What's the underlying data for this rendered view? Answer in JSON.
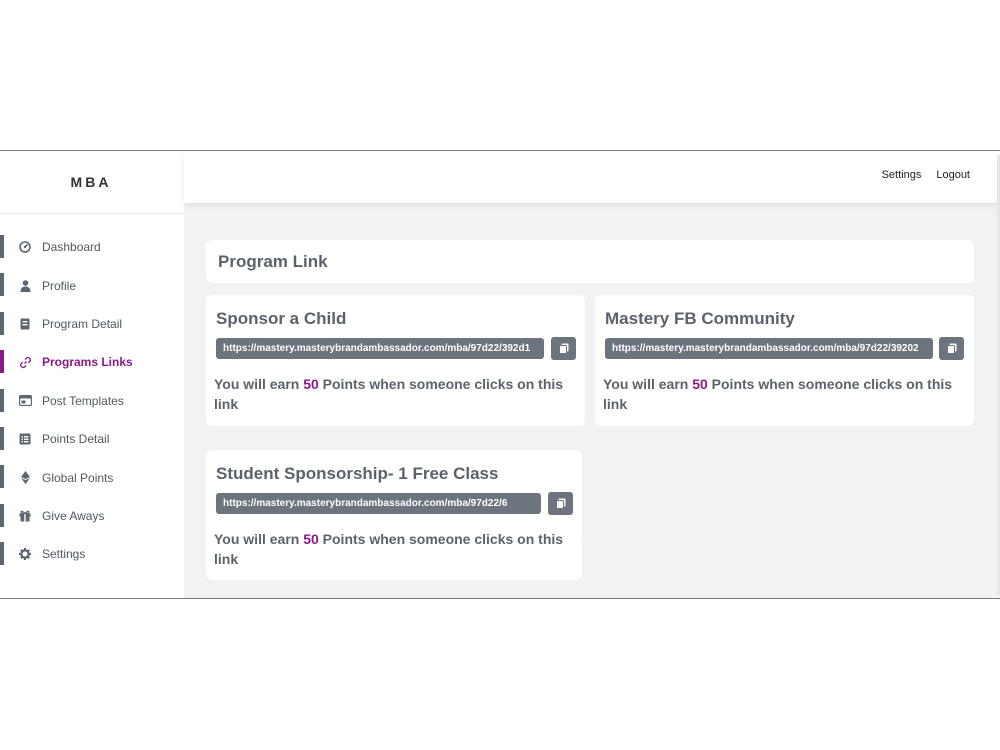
{
  "brand": "MBA",
  "topbar": {
    "settings": "Settings",
    "logout": "Logout"
  },
  "sidebar": {
    "items": [
      {
        "label": "Dashboard",
        "icon": "dashboard-gauge-icon"
      },
      {
        "label": "Profile",
        "icon": "user-icon"
      },
      {
        "label": "Program Detail",
        "icon": "file-icon"
      },
      {
        "label": "Programs Links",
        "icon": "link-icon",
        "active": true
      },
      {
        "label": "Post Templates",
        "icon": "template-icon"
      },
      {
        "label": "Points Detail",
        "icon": "list-icon"
      },
      {
        "label": "Global Points",
        "icon": "ethereum-icon"
      },
      {
        "label": "Give Aways",
        "icon": "gift-icon"
      },
      {
        "label": "Settings",
        "icon": "gear-icon"
      }
    ]
  },
  "main": {
    "title": "Program Link",
    "cards": [
      {
        "name": "Sponsor a Child",
        "url": "https://mastery.masterybrandambassador.com/mba/97d22/392d1",
        "earn_prefix": "You will earn",
        "points": "50",
        "earn_suffix": "Points when someone clicks on this link"
      },
      {
        "name": "Mastery FB Community",
        "url": "https://mastery.masterybrandambassador.com/mba/97d22/39202",
        "earn_prefix": "You will earn",
        "points": "50",
        "earn_suffix": "Points when someone clicks on this link"
      },
      {
        "name": "Student Sponsorship- 1 Free Class",
        "url": "https://mastery.masterybrandambassador.com/mba/97d22/6",
        "earn_prefix": "You will earn",
        "points": "50",
        "earn_suffix": "Points when someone clicks on this link"
      }
    ]
  },
  "colors": {
    "accent": "#8b1a89",
    "pill": "#6c757d",
    "background": "#f2f2f2"
  }
}
